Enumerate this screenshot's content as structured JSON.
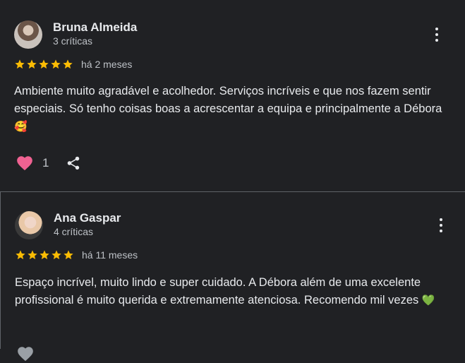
{
  "reviews": [
    {
      "name": "Bruna Almeida",
      "subtitle": "3 críticas",
      "rating": 5,
      "time": "há 2 meses",
      "text": "Ambiente muito agradável e acolhedor. Serviços incríveis e que nos fazem sentir especiais. Só tenho coisas boas a acrescentar a equipa e principalmente a Débora",
      "emoji": "🥰",
      "likes": "1"
    },
    {
      "name": "Ana Gaspar",
      "subtitle": "4 críticas",
      "rating": 5,
      "time": "há 11 meses",
      "text": "Espaço incrível, muito lindo e super cuidado. A Débora além de uma excelente profissional é muito querida e extremamente atenciosa. Recomendo mil vezes",
      "emoji": "💚"
    }
  ],
  "colors": {
    "background": "#202124",
    "star": "#fbbc04",
    "heart": "#f06292"
  },
  "icons": [
    "star-icon",
    "heart-icon",
    "share-icon",
    "more-vert-icon"
  ]
}
